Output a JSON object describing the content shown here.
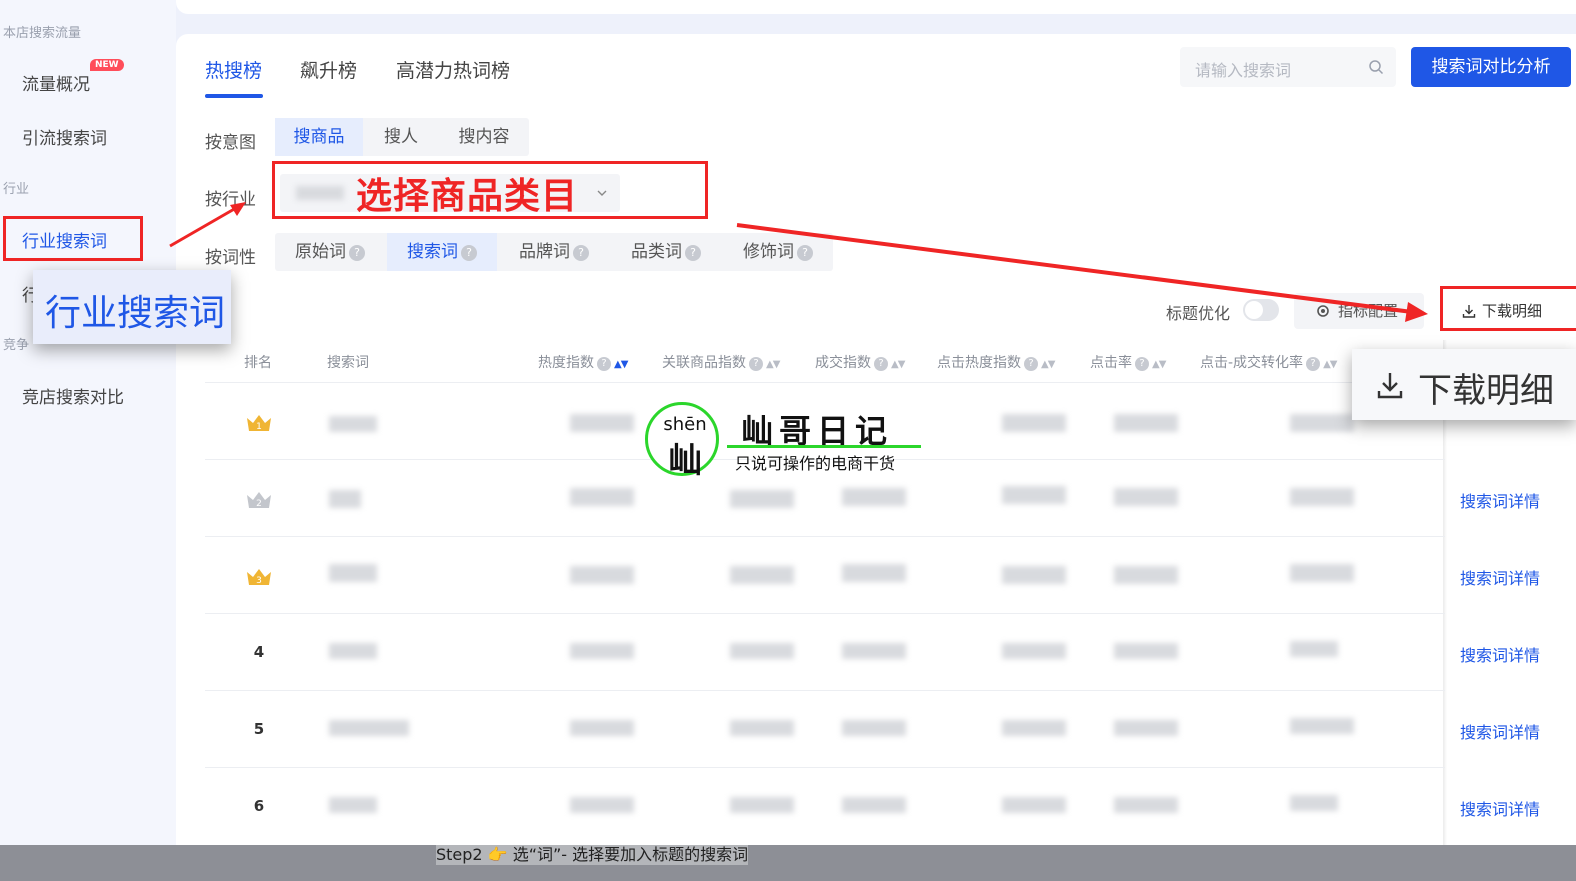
{
  "sidebar": {
    "section_store_search": "本店搜索流量",
    "item_overview": "流量概况",
    "new_badge": "NEW",
    "item_traffic_words": "引流搜索词",
    "section_industry": "行业",
    "item_industry_words": "行业搜索词",
    "item_partial": "行",
    "section_compete": "竞争",
    "item_compete_compare": "竞店搜索对比",
    "zoom_label": "行业搜索词"
  },
  "tabs": [
    {
      "label": "热搜榜",
      "active": true
    },
    {
      "label": "飙升榜",
      "active": false
    },
    {
      "label": "高潜力热词榜",
      "active": false
    }
  ],
  "search": {
    "placeholder": "请输入搜索词"
  },
  "compare_button": "搜索词对比分析",
  "filters": {
    "intent_label": "按意图",
    "intent_options": [
      "搜商品",
      "搜人",
      "搜内容"
    ],
    "industry_label": "按行业",
    "industry_annotation": "选择商品类目",
    "property_label": "按词性",
    "property_options": [
      "原始词",
      "搜索词",
      "品牌词",
      "品类词",
      "修饰词"
    ]
  },
  "toolbar": {
    "title_opt_label": "标题优化",
    "config_label": "指标配置",
    "download_label": "下载明细",
    "download_zoom_label": "下载明细"
  },
  "table": {
    "headers": [
      "排名",
      "搜索词",
      "热度指数",
      "关联商品指数",
      "成交指数",
      "点击热度指数",
      "点击率",
      "点击-成交转化率"
    ],
    "ranks": [
      "1",
      "2",
      "3",
      "4",
      "5",
      "6"
    ],
    "detail_link": "搜索词详情"
  },
  "watermark": {
    "pinyin": "shēn",
    "char": "屾",
    "title": "屾哥日记",
    "subtitle": "只说可操作的电商干货"
  },
  "step_caption": "Step2  👉  选“词”- 选择要加入标题的搜索词",
  "colors": {
    "accent": "#1f57e6",
    "annotation_red": "#ef2525",
    "watermark_green": "#2bd62b",
    "crown_gold": "#f0b534",
    "crown_silver": "#c3c6cc"
  }
}
